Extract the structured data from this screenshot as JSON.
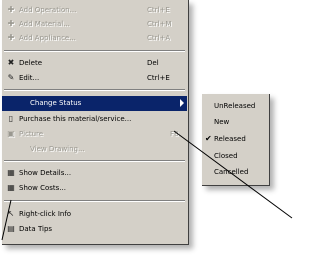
{
  "menu": {
    "items": [
      {
        "label": "Add Operation...",
        "shortcut": "Ctrl+E",
        "icon": "add-operation-icon",
        "disabled": true
      },
      {
        "label": "Add Material...",
        "shortcut": "Ctrl+M",
        "icon": "add-material-icon",
        "disabled": true
      },
      {
        "label": "Add Appliance...",
        "shortcut": "Ctrl+A",
        "icon": "add-appliance-icon",
        "disabled": true
      },
      {
        "label": "Delete",
        "shortcut": "Del",
        "icon": "delete-icon",
        "disabled": false
      },
      {
        "label": "Edit...",
        "shortcut": "Ctrl+E",
        "icon": "edit-icon",
        "disabled": false
      },
      {
        "label": "Change Status",
        "shortcut": "",
        "icon": "",
        "disabled": false,
        "selected": true
      },
      {
        "label": "Purchase this material/service...",
        "shortcut": "",
        "icon": "purchase-icon",
        "disabled": false
      },
      {
        "label": "Picture",
        "shortcut": "F8",
        "icon": "picture-icon",
        "disabled": true
      },
      {
        "label": "View Drawing...",
        "shortcut": "",
        "icon": "",
        "disabled": true
      },
      {
        "label": "Show Details...",
        "shortcut": "",
        "icon": "show-details-icon",
        "disabled": false
      },
      {
        "label": "Show Costs...",
        "shortcut": "",
        "icon": "show-costs-icon",
        "disabled": false
      },
      {
        "label": "Right-click Info",
        "shortcut": "",
        "icon": "right-click-info-icon",
        "disabled": false
      },
      {
        "label": "Data Tips",
        "shortcut": "",
        "icon": "data-tips-icon",
        "disabled": false
      }
    ]
  },
  "submenu": {
    "items": [
      {
        "label": "UnReleased",
        "checked": false
      },
      {
        "label": "New",
        "checked": false
      },
      {
        "label": "Released",
        "checked": true
      },
      {
        "label": "Closed",
        "checked": false
      },
      {
        "label": "Cancelled",
        "checked": false
      }
    ]
  },
  "colors": {
    "menu_bg": "#d4d0c8",
    "selection": "#0a246a",
    "disabled_text": "#9a9890"
  }
}
